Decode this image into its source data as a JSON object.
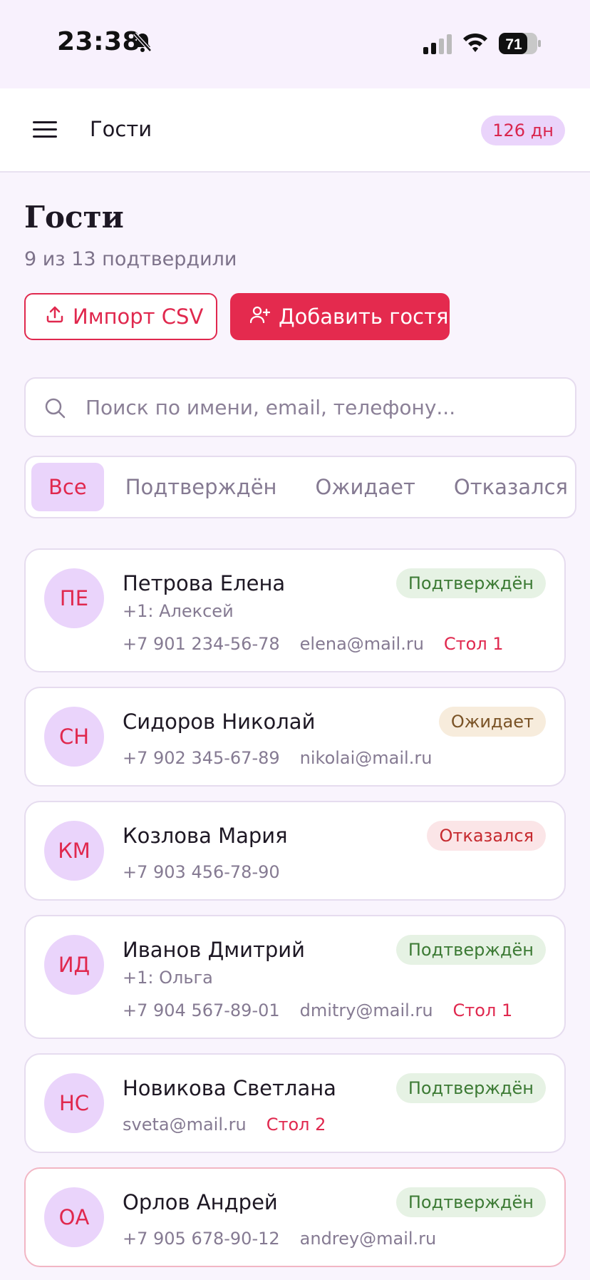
{
  "status_bar": {
    "time": "23:38",
    "battery": "71"
  },
  "header": {
    "title": "Гости",
    "days_badge": "126 дн"
  },
  "page": {
    "title": "Гости",
    "subtitle": "9 из 13 подтвердили"
  },
  "actions": {
    "import_label": "Импорт CSV",
    "add_label": "Добавить гостя"
  },
  "search": {
    "placeholder": "Поиск по имени, email, телефону..."
  },
  "filters": [
    "Все",
    "Подтверждён",
    "Ожидает",
    "Отказался"
  ],
  "active_filter": "Все",
  "guests": [
    {
      "initials": "ПЕ",
      "name": "Петрова Елена",
      "plus_one": "+1: Алексей",
      "phone": "+7 901 234-56-78",
      "email": "elena@mail.ru",
      "table": "Стол 1",
      "status": "Подтверждён"
    },
    {
      "initials": "СН",
      "name": "Сидоров Николай",
      "phone": "+7 902 345-67-89",
      "email": "nikolai@mail.ru",
      "status": "Ожидает"
    },
    {
      "initials": "КМ",
      "name": "Козлова Мария",
      "phone": "+7 903 456-78-90",
      "status": "Отказался"
    },
    {
      "initials": "ИД",
      "name": "Иванов Дмитрий",
      "plus_one": "+1: Ольга",
      "phone": "+7 904 567-89-01",
      "email": "dmitry@mail.ru",
      "table": "Стол 1",
      "status": "Подтверждён"
    },
    {
      "initials": "НС",
      "name": "Новикова Светлана",
      "email": "sveta@mail.ru",
      "table": "Стол 2",
      "status": "Подтверждён"
    },
    {
      "initials": "ОА",
      "name": "Орлов Андрей",
      "phone": "+7 905 678-90-12",
      "email": "andrey@mail.ru",
      "status": "Подтверждён"
    }
  ],
  "colors": {
    "accent": "#e42a4e",
    "lavender": "#ead4fb",
    "background": "#f9f4fd"
  }
}
